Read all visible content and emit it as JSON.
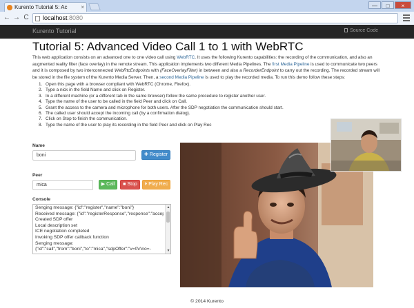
{
  "browser": {
    "tab_title": "Kurento Tutorial 5: Ac",
    "tab_close": "×",
    "url_host": "localhost",
    "url_port": ":8080",
    "back_symbol": "←",
    "forward_symbol": "→",
    "reload_symbol": "C",
    "window_controls": {
      "minimize": "—",
      "maximize": "□",
      "close": "×"
    }
  },
  "navbar": {
    "brand": "Kurento Tutorial",
    "source_link": "Source Code"
  },
  "page": {
    "title": "Tutorial 5: Advanced Video Call 1 to 1 with WebRTC",
    "intro": {
      "t1": "This web application consists on an advanced one to one video call using ",
      "link_webrtc": "WebRTC",
      "t2": ". It uses the following Kurento capabilities: the recording of the communication, and also an augmented reality filter (face overlay) in the remote stream. This application implements two different Media Pipelines. The ",
      "link_first": "first Media Pipeline",
      "t3": " is used to communicate two peers and it is composed by two interconnected ",
      "em_webrtc": "WebRtcEndpoints",
      "t4": " with ",
      "em_filter": "(FaceOverlayFilter)",
      "t5": " in between and also a ",
      "em_recorder": "RecorderEndpoint",
      "t6": " to carry out the recording. The recorded stream will be stored in the file system of the Kurento Media Server. Then, a ",
      "link_second": "second Media Pipeline",
      "t7": " is used to play the recorded media. To run this demo follow these steps:"
    },
    "steps": [
      {
        "num": "1.",
        "text": "Open this page with a browser compliant with WebRTC (Chrome, Firefox)."
      },
      {
        "num": "2.",
        "text": "Type a nick in the field Name and click on Register."
      },
      {
        "num": "3.",
        "text": "In a different machine (or a different tab in the same browser) follow the same procedure to register another user."
      },
      {
        "num": "4.",
        "text": "Type the name of the user to be called in the field Peer and click on Call."
      },
      {
        "num": "5.",
        "text": "Grant the access to the camera and microphone for both users. After the SDP negotiation the communication should start."
      },
      {
        "num": "6.",
        "text": "The called user should accept the incoming call (by a confirmation dialog)."
      },
      {
        "num": "7.",
        "text": "Click on Stop to finish the communication."
      },
      {
        "num": "8.",
        "text": "Type the name of the user to play its recording in the field Peer and click on Play Rec"
      }
    ]
  },
  "form": {
    "name_label": "Name",
    "name_value": "boni",
    "register_label": "Register",
    "peer_label": "Peer",
    "peer_value": "mica",
    "call_label": "Call",
    "stop_label": "Stop",
    "playrec_label": "Play Rec"
  },
  "console": {
    "label": "Console",
    "lines": [
      "Senging message: {\"id\":\"register\",\"name\":\"boni\"}",
      "Received message: {\"id\":\"registerResponse\",\"response\":\"accepted\"}",
      "Created SDP offer",
      "Local description set",
      "ICE negotiation completed",
      "Invoking SDP offer callback function",
      "Senging message:",
      "{\"id\":\"call\",\"from\":\"boni\",\"to\":\"mica\",\"sdpOffer\":\"v=0\\r\\no=-"
    ]
  },
  "footer": {
    "text": "© 2014 Kurento"
  },
  "colors": {
    "navbar_bg": "#262626",
    "link": "#2a6496",
    "register_button": "#428bca",
    "call_button": "#5cb85c",
    "stop_button": "#d9534f",
    "playrec_button": "#f0ad4e"
  },
  "icons": {
    "register": "plus-icon",
    "call": "play-icon",
    "stop": "stop-icon",
    "playrec": "play-circle-icon",
    "source": "file-icon"
  }
}
